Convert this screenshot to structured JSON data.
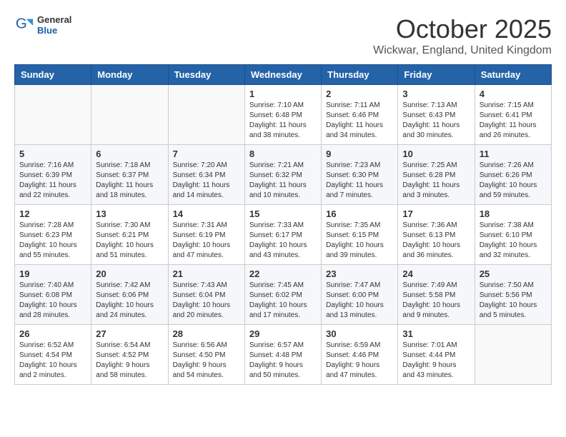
{
  "header": {
    "logo": {
      "general": "General",
      "blue": "Blue"
    },
    "title": "October 2025",
    "location": "Wickwar, England, United Kingdom"
  },
  "weekdays": [
    "Sunday",
    "Monday",
    "Tuesday",
    "Wednesday",
    "Thursday",
    "Friday",
    "Saturday"
  ],
  "weeks": [
    [
      {
        "day": "",
        "info": ""
      },
      {
        "day": "",
        "info": ""
      },
      {
        "day": "",
        "info": ""
      },
      {
        "day": "1",
        "info": "Sunrise: 7:10 AM\nSunset: 6:48 PM\nDaylight: 11 hours\nand 38 minutes."
      },
      {
        "day": "2",
        "info": "Sunrise: 7:11 AM\nSunset: 6:46 PM\nDaylight: 11 hours\nand 34 minutes."
      },
      {
        "day": "3",
        "info": "Sunrise: 7:13 AM\nSunset: 6:43 PM\nDaylight: 11 hours\nand 30 minutes."
      },
      {
        "day": "4",
        "info": "Sunrise: 7:15 AM\nSunset: 6:41 PM\nDaylight: 11 hours\nand 26 minutes."
      }
    ],
    [
      {
        "day": "5",
        "info": "Sunrise: 7:16 AM\nSunset: 6:39 PM\nDaylight: 11 hours\nand 22 minutes."
      },
      {
        "day": "6",
        "info": "Sunrise: 7:18 AM\nSunset: 6:37 PM\nDaylight: 11 hours\nand 18 minutes."
      },
      {
        "day": "7",
        "info": "Sunrise: 7:20 AM\nSunset: 6:34 PM\nDaylight: 11 hours\nand 14 minutes."
      },
      {
        "day": "8",
        "info": "Sunrise: 7:21 AM\nSunset: 6:32 PM\nDaylight: 11 hours\nand 10 minutes."
      },
      {
        "day": "9",
        "info": "Sunrise: 7:23 AM\nSunset: 6:30 PM\nDaylight: 11 hours\nand 7 minutes."
      },
      {
        "day": "10",
        "info": "Sunrise: 7:25 AM\nSunset: 6:28 PM\nDaylight: 11 hours\nand 3 minutes."
      },
      {
        "day": "11",
        "info": "Sunrise: 7:26 AM\nSunset: 6:26 PM\nDaylight: 10 hours\nand 59 minutes."
      }
    ],
    [
      {
        "day": "12",
        "info": "Sunrise: 7:28 AM\nSunset: 6:23 PM\nDaylight: 10 hours\nand 55 minutes."
      },
      {
        "day": "13",
        "info": "Sunrise: 7:30 AM\nSunset: 6:21 PM\nDaylight: 10 hours\nand 51 minutes."
      },
      {
        "day": "14",
        "info": "Sunrise: 7:31 AM\nSunset: 6:19 PM\nDaylight: 10 hours\nand 47 minutes."
      },
      {
        "day": "15",
        "info": "Sunrise: 7:33 AM\nSunset: 6:17 PM\nDaylight: 10 hours\nand 43 minutes."
      },
      {
        "day": "16",
        "info": "Sunrise: 7:35 AM\nSunset: 6:15 PM\nDaylight: 10 hours\nand 39 minutes."
      },
      {
        "day": "17",
        "info": "Sunrise: 7:36 AM\nSunset: 6:13 PM\nDaylight: 10 hours\nand 36 minutes."
      },
      {
        "day": "18",
        "info": "Sunrise: 7:38 AM\nSunset: 6:10 PM\nDaylight: 10 hours\nand 32 minutes."
      }
    ],
    [
      {
        "day": "19",
        "info": "Sunrise: 7:40 AM\nSunset: 6:08 PM\nDaylight: 10 hours\nand 28 minutes."
      },
      {
        "day": "20",
        "info": "Sunrise: 7:42 AM\nSunset: 6:06 PM\nDaylight: 10 hours\nand 24 minutes."
      },
      {
        "day": "21",
        "info": "Sunrise: 7:43 AM\nSunset: 6:04 PM\nDaylight: 10 hours\nand 20 minutes."
      },
      {
        "day": "22",
        "info": "Sunrise: 7:45 AM\nSunset: 6:02 PM\nDaylight: 10 hours\nand 17 minutes."
      },
      {
        "day": "23",
        "info": "Sunrise: 7:47 AM\nSunset: 6:00 PM\nDaylight: 10 hours\nand 13 minutes."
      },
      {
        "day": "24",
        "info": "Sunrise: 7:49 AM\nSunset: 5:58 PM\nDaylight: 10 hours\nand 9 minutes."
      },
      {
        "day": "25",
        "info": "Sunrise: 7:50 AM\nSunset: 5:56 PM\nDaylight: 10 hours\nand 5 minutes."
      }
    ],
    [
      {
        "day": "26",
        "info": "Sunrise: 6:52 AM\nSunset: 4:54 PM\nDaylight: 10 hours\nand 2 minutes."
      },
      {
        "day": "27",
        "info": "Sunrise: 6:54 AM\nSunset: 4:52 PM\nDaylight: 9 hours\nand 58 minutes."
      },
      {
        "day": "28",
        "info": "Sunrise: 6:56 AM\nSunset: 4:50 PM\nDaylight: 9 hours\nand 54 minutes."
      },
      {
        "day": "29",
        "info": "Sunrise: 6:57 AM\nSunset: 4:48 PM\nDaylight: 9 hours\nand 50 minutes."
      },
      {
        "day": "30",
        "info": "Sunrise: 6:59 AM\nSunset: 4:46 PM\nDaylight: 9 hours\nand 47 minutes."
      },
      {
        "day": "31",
        "info": "Sunrise: 7:01 AM\nSunset: 4:44 PM\nDaylight: 9 hours\nand 43 minutes."
      },
      {
        "day": "",
        "info": ""
      }
    ]
  ]
}
